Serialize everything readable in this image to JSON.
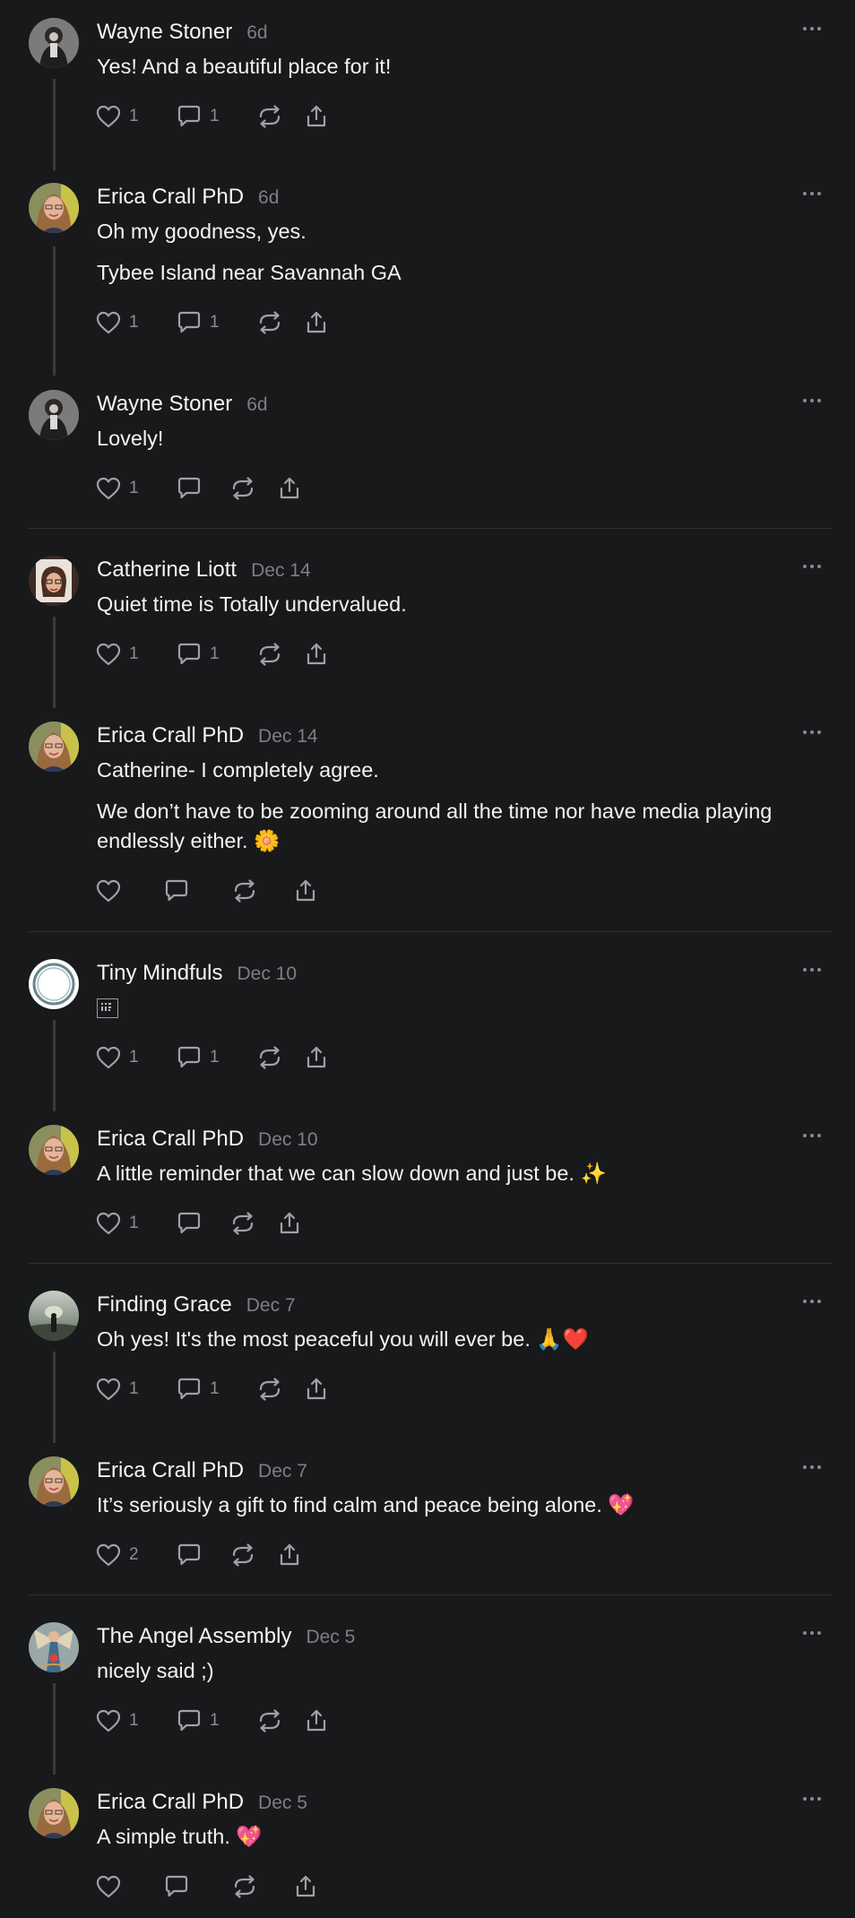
{
  "colors": {
    "background": "#18191b",
    "text": "#f3f3f3",
    "muted": "#7e7f82",
    "icon": "#a0a1a4",
    "thread_line": "#3a3b3d",
    "divider": "#2f3032"
  },
  "icons": {
    "like": "heart-icon",
    "reply": "comment-icon",
    "repost": "repost-icon",
    "share": "share-icon",
    "more": "more-dots-icon",
    "gif": "gif-icon"
  },
  "posts": [
    {
      "author": "Wayne Stoner",
      "time": "6d",
      "avatar": "wayne",
      "lines": [
        "Yes! And a beautiful place for it!"
      ],
      "likes": "1",
      "replies": "1"
    },
    {
      "author": "Erica Crall PhD",
      "time": "6d",
      "avatar": "erica",
      "lines": [
        "Oh my goodness, yes.",
        "Tybee Island near Savannah GA"
      ],
      "likes": "1",
      "replies": "1"
    },
    {
      "author": "Wayne Stoner",
      "time": "6d",
      "avatar": "wayne",
      "lines": [
        "Lovely!"
      ],
      "likes": "1",
      "replies": ""
    },
    {
      "author": "Catherine Liott",
      "time": "Dec 14",
      "avatar": "catherine",
      "lines": [
        "Quiet time is Totally undervalued."
      ],
      "likes": "1",
      "replies": "1"
    },
    {
      "author": "Erica Crall PhD",
      "time": "Dec 14",
      "avatar": "erica",
      "lines": [
        "Catherine- I completely agree.",
        "We don’t have to be zooming around all the time nor have media playing endlessly either. 🌼"
      ],
      "likes": "",
      "replies": ""
    },
    {
      "author": "Tiny Mindfuls",
      "time": "Dec 10",
      "avatar": "tiny",
      "lines": [],
      "likes": "1",
      "replies": "1"
    },
    {
      "author": "Erica Crall PhD",
      "time": "Dec 10",
      "avatar": "erica",
      "lines": [
        "A little reminder that we can slow down and just be. ✨"
      ],
      "likes": "1",
      "replies": ""
    },
    {
      "author": "Finding Grace",
      "time": "Dec 7",
      "avatar": "grace",
      "lines": [
        "Oh yes! It's the most peaceful you will ever be. 🙏❤️"
      ],
      "likes": "1",
      "replies": "1"
    },
    {
      "author": "Erica Crall PhD",
      "time": "Dec 7",
      "avatar": "erica",
      "lines": [
        "It’s seriously a gift to find calm and peace being alone. 💖"
      ],
      "likes": "2",
      "replies": ""
    },
    {
      "author": "The Angel Assembly",
      "time": "Dec 5",
      "avatar": "angel",
      "lines": [
        "nicely said ;)"
      ],
      "likes": "1",
      "replies": "1"
    },
    {
      "author": "Erica Crall PhD",
      "time": "Dec 5",
      "avatar": "erica",
      "lines": [
        "A simple truth. 💖"
      ],
      "likes": "",
      "replies": ""
    }
  ]
}
